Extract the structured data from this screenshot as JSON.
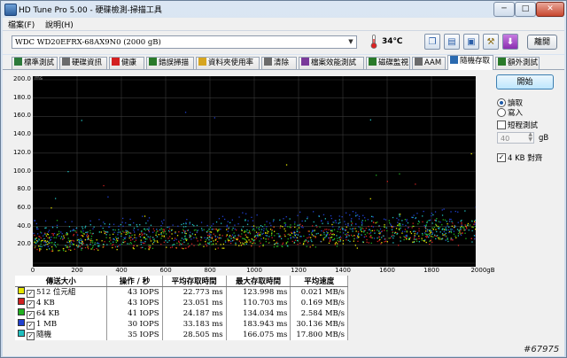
{
  "window": {
    "title": "HD Tune Pro  5.00 - 硬碟檢測-掃描工具",
    "min_label": "─",
    "max_label": "□",
    "close_label": "✕"
  },
  "menu": {
    "file": "檔案(F)",
    "help": "說明(H)"
  },
  "toolbar": {
    "drive": "WDC  WD20EFRX-68AX9N0 (2000 gB)",
    "temperature": "34℃",
    "exit_label": "離開"
  },
  "tabs": [
    {
      "label": "標準測試",
      "icon": "gauge-icon",
      "color": "#2c7a3a"
    },
    {
      "label": "硬碟資訊",
      "icon": "info-icon",
      "color": "#6b6b6b"
    },
    {
      "label": "健康",
      "icon": "health-cross-icon",
      "color": "#d32020"
    },
    {
      "label": "錯誤掃描",
      "icon": "magnifier-icon",
      "color": "#2a7a2a"
    },
    {
      "label": "資料夾使用率",
      "icon": "folder-icon",
      "color": "#d6a520"
    },
    {
      "label": "清除",
      "icon": "trash-icon",
      "color": "#6b6b6b"
    },
    {
      "label": "檔案效能測試",
      "icon": "file-gauge-icon",
      "color": "#7a3a9a"
    },
    {
      "label": "磁碟監視",
      "icon": "monitor-icon",
      "color": "#2a7a2a"
    },
    {
      "label": "AAM",
      "icon": "speaker-icon",
      "color": "#6b6b6b"
    },
    {
      "label": "隨機存取",
      "icon": "random-access-icon",
      "color": "#2a6ab0"
    },
    {
      "label": "額外測試",
      "icon": "extra-tests-icon",
      "color": "#2a7a2a"
    }
  ],
  "right_panel": {
    "start_label": "開始",
    "read_label": "讀取",
    "write_label": "寫入",
    "mode_selected": "read",
    "short_test_label": "短程測試",
    "short_test_checked": false,
    "short_test_value": "40",
    "short_test_unit": "gB",
    "align_label": "4 KB 對齊",
    "align_checked": true
  },
  "chart_data": {
    "type": "scatter",
    "y_unit": "ms",
    "x_unit": "gB",
    "ylim": [
      0,
      200
    ],
    "xlim": [
      0,
      2000
    ],
    "yticks": [
      "200.0",
      "180.0",
      "160.0",
      "140.0",
      "120.0",
      "100.0",
      "80.0",
      "60.0",
      "40.0",
      "20.0"
    ],
    "xticks": [
      "0",
      "200",
      "400",
      "600",
      "800",
      "1000",
      "1200",
      "1400",
      "1600",
      "1800",
      "2000gB"
    ],
    "grid": true,
    "series": [
      {
        "name": "512 位元組",
        "color": "#e6e600",
        "mean_access_ms": 22.773,
        "max_access_ms": 123.998
      },
      {
        "name": "4 KB",
        "color": "#d02020",
        "mean_access_ms": 23.051,
        "max_access_ms": 110.703
      },
      {
        "name": "64 KB",
        "color": "#20b020",
        "mean_access_ms": 24.187,
        "max_access_ms": 134.034
      },
      {
        "name": "1 MB",
        "color": "#2040d0",
        "mean_access_ms": 33.183,
        "max_access_ms": 183.943
      },
      {
        "name": "隨機",
        "color": "#20c0c0",
        "mean_access_ms": 28.505,
        "max_access_ms": 166.075
      }
    ]
  },
  "results": {
    "headers": [
      "傳送大小",
      "操作 / 秒",
      "平均存取時間",
      "最大存取時間",
      "平均速度"
    ],
    "rows": [
      {
        "size": "512 位元組",
        "iops": "43 IOPS",
        "avg": "22.773 ms",
        "max": "123.998 ms",
        "speed": "0.021 MB/s"
      },
      {
        "size": "4 KB",
        "iops": "43 IOPS",
        "avg": "23.051 ms",
        "max": "110.703 ms",
        "speed": "0.169 MB/s"
      },
      {
        "size": "64 KB",
        "iops": "41 IOPS",
        "avg": "24.187 ms",
        "max": "134.034 ms",
        "speed": "2.584 MB/s"
      },
      {
        "size": "1 MB",
        "iops": "30 IOPS",
        "avg": "33.183 ms",
        "max": "183.943 ms",
        "speed": "30.136 MB/s"
      },
      {
        "size": "隨機",
        "iops": "35 IOPS",
        "avg": "28.505 ms",
        "max": "166.075 ms",
        "speed": "17.800 MB/s"
      }
    ]
  },
  "watermark": "#67975"
}
